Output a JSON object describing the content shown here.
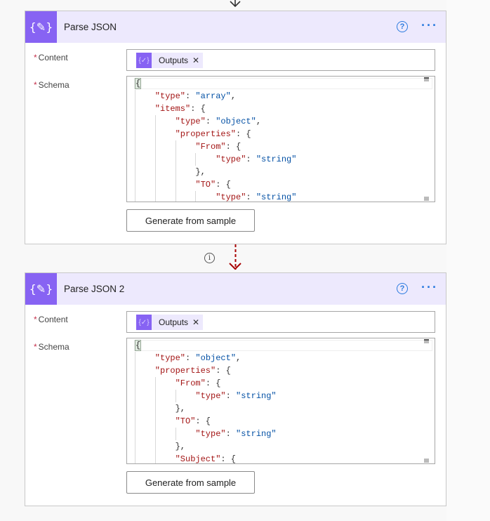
{
  "colors": {
    "accent": "#8763f3",
    "header_bg": "#ede9fd",
    "connector": "#a80000",
    "link": "#2b7bdf"
  },
  "icons": {
    "action": "json-braces-icon",
    "help": "question-circle-icon",
    "more": "ellipsis-icon",
    "info": "info-icon",
    "remove": "close-icon"
  },
  "cards": [
    {
      "title": "Parse JSON",
      "content_label": "Content",
      "schema_label": "Schema",
      "token_label": "Outputs",
      "button_label": "Generate from sample",
      "schema_lines": [
        {
          "indent": 0,
          "tokens": [
            [
              "p",
              "{"
            ]
          ]
        },
        {
          "indent": 1,
          "tokens": [
            [
              "k",
              "\"type\""
            ],
            [
              "p",
              ": "
            ],
            [
              "s",
              "\"array\""
            ],
            [
              "p",
              ","
            ]
          ]
        },
        {
          "indent": 1,
          "tokens": [
            [
              "k",
              "\"items\""
            ],
            [
              "p",
              ": {"
            ]
          ]
        },
        {
          "indent": 2,
          "tokens": [
            [
              "k",
              "\"type\""
            ],
            [
              "p",
              ": "
            ],
            [
              "s",
              "\"object\""
            ],
            [
              "p",
              ","
            ]
          ]
        },
        {
          "indent": 2,
          "tokens": [
            [
              "k",
              "\"properties\""
            ],
            [
              "p",
              ": {"
            ]
          ]
        },
        {
          "indent": 3,
          "tokens": [
            [
              "k",
              "\"From\""
            ],
            [
              "p",
              ": {"
            ]
          ]
        },
        {
          "indent": 4,
          "tokens": [
            [
              "k",
              "\"type\""
            ],
            [
              "p",
              ": "
            ],
            [
              "s",
              "\"string\""
            ]
          ]
        },
        {
          "indent": 3,
          "tokens": [
            [
              "p",
              "},"
            ]
          ]
        },
        {
          "indent": 3,
          "tokens": [
            [
              "k",
              "\"TO\""
            ],
            [
              "p",
              ": {"
            ]
          ]
        },
        {
          "indent": 4,
          "tokens": [
            [
              "k",
              "\"type\""
            ],
            [
              "p",
              ": "
            ],
            [
              "s",
              "\"string\""
            ]
          ]
        }
      ]
    },
    {
      "title": "Parse JSON 2",
      "content_label": "Content",
      "schema_label": "Schema",
      "token_label": "Outputs",
      "button_label": "Generate from sample",
      "schema_lines": [
        {
          "indent": 0,
          "tokens": [
            [
              "p",
              "{"
            ]
          ]
        },
        {
          "indent": 1,
          "tokens": [
            [
              "k",
              "\"type\""
            ],
            [
              "p",
              ": "
            ],
            [
              "s",
              "\"object\""
            ],
            [
              "p",
              ","
            ]
          ]
        },
        {
          "indent": 1,
          "tokens": [
            [
              "k",
              "\"properties\""
            ],
            [
              "p",
              ": {"
            ]
          ]
        },
        {
          "indent": 2,
          "tokens": [
            [
              "k",
              "\"From\""
            ],
            [
              "p",
              ": {"
            ]
          ]
        },
        {
          "indent": 3,
          "tokens": [
            [
              "k",
              "\"type\""
            ],
            [
              "p",
              ": "
            ],
            [
              "s",
              "\"string\""
            ]
          ]
        },
        {
          "indent": 2,
          "tokens": [
            [
              "p",
              "},"
            ]
          ]
        },
        {
          "indent": 2,
          "tokens": [
            [
              "k",
              "\"TO\""
            ],
            [
              "p",
              ": {"
            ]
          ]
        },
        {
          "indent": 3,
          "tokens": [
            [
              "k",
              "\"type\""
            ],
            [
              "p",
              ": "
            ],
            [
              "s",
              "\"string\""
            ]
          ]
        },
        {
          "indent": 2,
          "tokens": [
            [
              "p",
              "},"
            ]
          ]
        },
        {
          "indent": 2,
          "tokens": [
            [
              "k",
              "\"Subject\""
            ],
            [
              "p",
              ": {"
            ]
          ]
        }
      ]
    }
  ]
}
